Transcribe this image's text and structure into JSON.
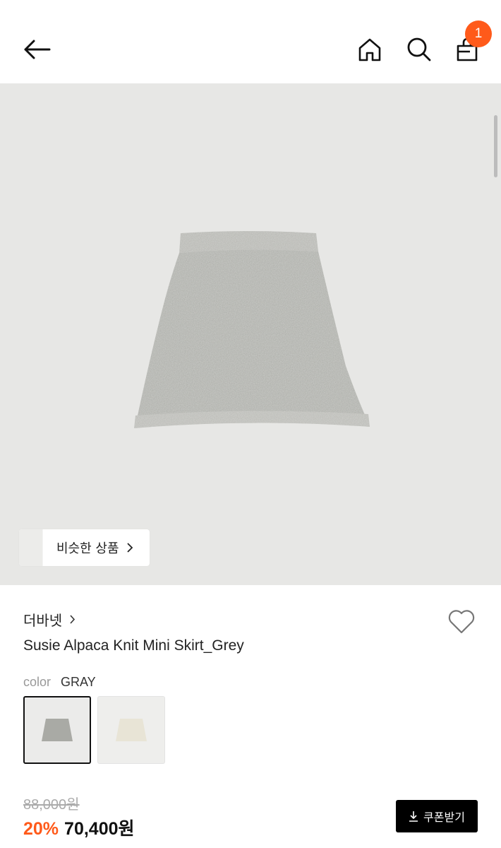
{
  "header": {
    "cart_count": "1",
    "icons": [
      "arrow-left-icon",
      "home-icon",
      "search-icon",
      "shopping-bag-icon"
    ]
  },
  "hero": {
    "similar_label": "비슷한 상품"
  },
  "product": {
    "brand": "더바넷",
    "name": "Susie Alpaca Knit Mini Skirt_Grey",
    "color_label": "color",
    "color_value": "GRAY",
    "original_price": "88,000원",
    "discount": "20%",
    "sale_price": "70,400원",
    "coupon_label": "쿠폰받기"
  },
  "colors": {
    "accent": "#ff5a1a",
    "skirt_gray": "#a9aaa5",
    "skirt_ivory": "#e8e4d6"
  }
}
